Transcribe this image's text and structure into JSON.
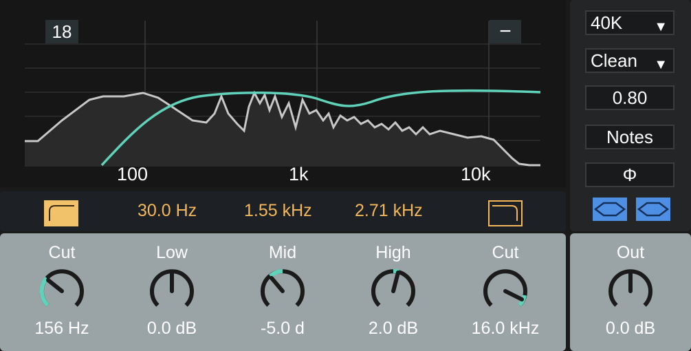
{
  "spectrum": {
    "db_range_label": "18",
    "collapse_symbol": "−",
    "freq_ticks": [
      "100",
      "1k",
      "10k"
    ]
  },
  "filters": {
    "low_cut_freq": "30.0 Hz",
    "mid_freq": "1.55 kHz",
    "high_freq": "2.71 kHz"
  },
  "knobs": [
    {
      "label": "Cut",
      "value": "156 Hz"
    },
    {
      "label": "Low",
      "value": "0.0 dB"
    },
    {
      "label": "Mid",
      "value": "-5.0 d"
    },
    {
      "label": "High",
      "value": "2.0 dB"
    },
    {
      "label": "Cut",
      "value": "16.0 kHz"
    }
  ],
  "side": {
    "rate": "40K",
    "mode": "Clean",
    "amount": "0.80",
    "notes": "Notes",
    "phase_symbol": "Φ"
  },
  "output": {
    "label": "Out",
    "value": "0.0 dB"
  },
  "colors": {
    "accent": "#f2b85a",
    "teal": "#5fd2b9",
    "blue": "#4f8fe3",
    "knob_panel": "#9aa3a5"
  }
}
